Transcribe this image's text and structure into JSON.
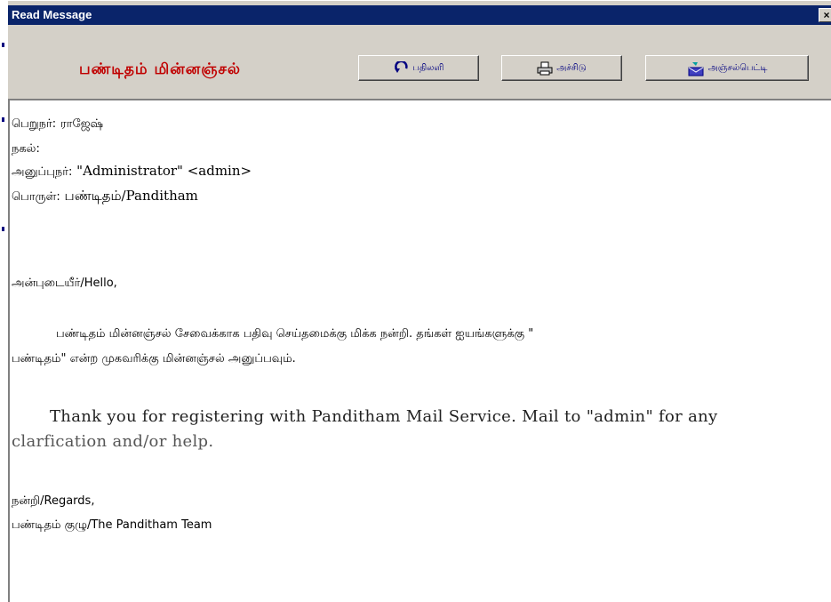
{
  "window": {
    "title": "Read Message",
    "close_glyph": "×"
  },
  "toolbar": {
    "logo_text": "பண்டிதம் மின்னஞ்சல்",
    "reply_label": "பதிலளி",
    "print_label": "அச்சிடு",
    "mailbox_label": "அஞ்சல்பெட்டி"
  },
  "message": {
    "to_label": "பெறுநர்:",
    "to_value": "ராஜேஷ்",
    "cc_label": "நகல்:",
    "from_label": "அனுப்புநர்:",
    "from_value": "\"Administrator\" <admin>",
    "subject_label": "பொருள்:",
    "subject_value": "பண்டிதம்/Panditham",
    "greeting": "அன்புடையீர்/Hello,",
    "tamil_para_line1": "பண்டிதம் மின்னஞ்சல் சேவைக்காக பதிவு செய்தமைக்கு மிக்க நன்றி. தங்கள் ஐயங்களுக்கு \"",
    "tamil_para_line2": "பண்டிதம்\" என்ற முகவரிக்கு மின்னஞ்சல் அனுப்பவும்.",
    "english_para_line1": "Thank you for registering with Panditham Mail Service.  Mail to \"admin\" for any",
    "english_para_line2": "clarfication and/or help.",
    "regards": "நன்றி/Regards,",
    "signature": "பண்டிதம் குழு/The Panditham Team"
  },
  "colors": {
    "titlebar": "#0a246a",
    "logo": "#c00000",
    "button_text": "#000080",
    "panel": "#d4d0c8"
  }
}
